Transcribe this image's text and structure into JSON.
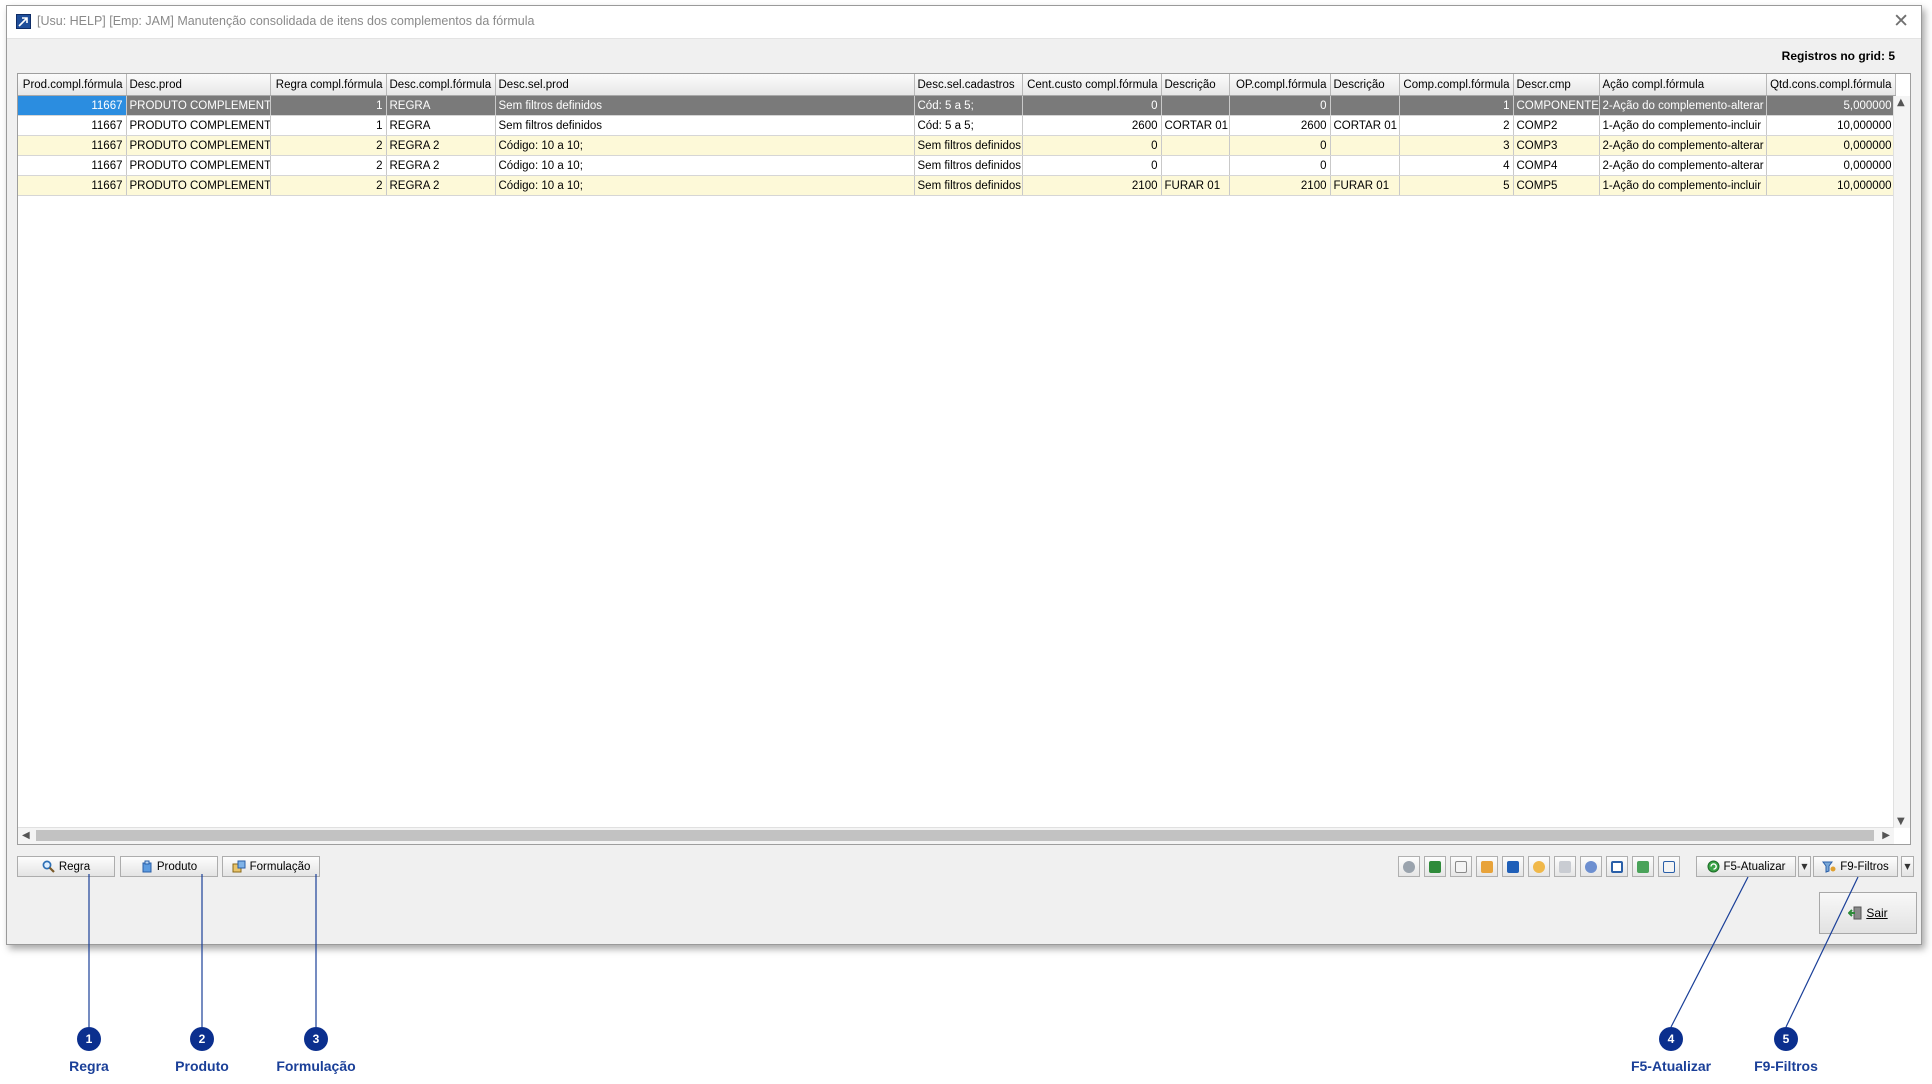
{
  "window": {
    "title": "[Usu: HELP] [Emp: JAM] Manutenção consolidada de itens dos complementos da fórmula",
    "close_glyph": "✕"
  },
  "records_label": "Registros no grid: 5",
  "grid": {
    "columns": [
      "Prod.compl.fórmula",
      "Desc.prod",
      "Regra compl.fórmula",
      "Desc.compl.fórmula",
      "Desc.sel.prod",
      "Desc.sel.cadastros",
      "Cent.custo compl.fórmula",
      "Descrição",
      "OP.compl.fórmula",
      "Descrição",
      "Comp.compl.fórmula",
      "Descr.cmp",
      "Ação compl.fórmula",
      "Qtd.cons.compl.fórmula"
    ],
    "rows": [
      [
        "11667",
        "PRODUTO COMPLEMENTO",
        "1",
        "REGRA",
        "Sem filtros definidos",
        "Cód: 5 a 5;",
        "0",
        "",
        "0",
        "",
        "1",
        "COMPONENTE",
        "2-Ação do complemento-alterar",
        "5,000000"
      ],
      [
        "11667",
        "PRODUTO COMPLEMENTO",
        "1",
        "REGRA",
        "Sem filtros definidos",
        "Cód: 5 a 5;",
        "2600",
        "CORTAR 01",
        "2600",
        "CORTAR 01",
        "2",
        "COMP2",
        "1-Ação do complemento-incluir",
        "10,000000"
      ],
      [
        "11667",
        "PRODUTO COMPLEMENTO",
        "2",
        "REGRA 2",
        "Código: 10 a 10;",
        "Sem filtros definidos",
        "0",
        "",
        "0",
        "",
        "3",
        "COMP3",
        "2-Ação do complemento-alterar",
        "0,000000"
      ],
      [
        "11667",
        "PRODUTO COMPLEMENTO",
        "2",
        "REGRA 2",
        "Código: 10 a 10;",
        "Sem filtros definidos",
        "0",
        "",
        "0",
        "",
        "4",
        "COMP4",
        "2-Ação do complemento-alterar",
        "0,000000"
      ],
      [
        "11667",
        "PRODUTO COMPLEMENTO",
        "2",
        "REGRA 2",
        "Código: 10 a 10;",
        "Sem filtros definidos",
        "2100",
        "FURAR 01",
        "2100",
        "FURAR 01",
        "5",
        "COMP5",
        "1-Ação do complemento-incluir",
        "10,000000"
      ]
    ]
  },
  "buttons": {
    "regra": "Regra",
    "produto": "Produto",
    "formulacao": "Formulação",
    "atualizar": "F5-Atualizar",
    "filtros": "F9-Filtros",
    "sair": "Sair"
  },
  "toolbar_icons": [
    "view-icon",
    "excel-icon",
    "document-icon",
    "folder-icon",
    "columns-icon",
    "palette-icon",
    "print-icon",
    "settings-icon",
    "window-icon",
    "export-icon",
    "checklist-icon"
  ],
  "callouts": [
    {
      "number": "1",
      "label": "Regra"
    },
    {
      "number": "2",
      "label": "Produto"
    },
    {
      "number": "3",
      "label": "Formulação"
    },
    {
      "number": "4",
      "label": "F5-Atualizar"
    },
    {
      "number": "5",
      "label": "F9-Filtros"
    }
  ],
  "colors": {
    "selected_row": "#7a7a7a",
    "selected_cell": "#2b8de0",
    "alt_row": "#fdf9d8",
    "callout": "#0b2f8e",
    "callout_label": "#1a3f98"
  }
}
